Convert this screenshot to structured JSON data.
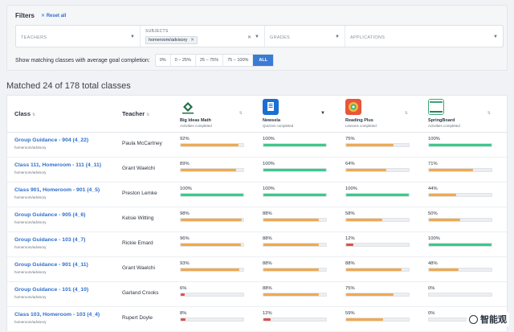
{
  "filters": {
    "title": "Filters",
    "reset_label": "✕ Reset all",
    "teachers_placeholder": "TEACHERS",
    "subjects_label": "SUBJECTS",
    "subjects_chip": "homeroom/advisory",
    "subjects_chip_remove": "✕",
    "subjects_clear": "✕",
    "grades_placeholder": "GRADES",
    "applications_placeholder": "APPLICATIONS",
    "completion_label": "Show matching classes with average goal completion:",
    "completion_options": [
      "0%",
      "0 – 25%",
      "25 – 75%",
      "75 – 100%",
      "ALL"
    ],
    "completion_selected": "ALL"
  },
  "results": {
    "title": "Matched 24 of 178 total classes",
    "col_class": "Class",
    "col_teacher": "Teacher",
    "sort_glyph": "⇅",
    "apps": [
      {
        "name": "Big Ideas Math",
        "metric": "Activities completed",
        "icon": "big-ideas-math-logo"
      },
      {
        "name": "Newsela",
        "metric": "Quizzes completed",
        "icon": "newsela-logo"
      },
      {
        "name": "Reading Plus",
        "metric": "Lessons completed",
        "icon": "reading-plus-logo"
      },
      {
        "name": "SpringBoard",
        "metric": "Activities completed",
        "icon": "springboard-logo"
      }
    ],
    "colors": {
      "green": "#3cc98a",
      "orange": "#f0a94f",
      "red": "#d9534f",
      "link": "#2f6fcf"
    },
    "rows": [
      {
        "name": "Group Guidance - 904 (4_22)",
        "sub": "homeroom/advisory",
        "teacher": "Paula McCartney",
        "metrics": [
          {
            "pct": "92%",
            "v": 0.92,
            "c": "orange"
          },
          {
            "pct": "100%",
            "v": 1.0,
            "c": "green"
          },
          {
            "pct": "75%",
            "v": 0.75,
            "c": "orange"
          },
          {
            "pct": "100%",
            "v": 1.0,
            "c": "green"
          }
        ]
      },
      {
        "name": "Class 111, Homeroom - 111 (4_11)",
        "sub": "homeroom/advisory",
        "teacher": "Grant Waelchi",
        "metrics": [
          {
            "pct": "89%",
            "v": 0.89,
            "c": "orange"
          },
          {
            "pct": "100%",
            "v": 1.0,
            "c": "green"
          },
          {
            "pct": "64%",
            "v": 0.64,
            "c": "orange"
          },
          {
            "pct": "71%",
            "v": 0.71,
            "c": "orange"
          }
        ]
      },
      {
        "name": "Class 901, Homeroom - 901 (4_5)",
        "sub": "homeroom/advisory",
        "teacher": "Preston Lemke",
        "metrics": [
          {
            "pct": "100%",
            "v": 1.0,
            "c": "green"
          },
          {
            "pct": "100%",
            "v": 1.0,
            "c": "green"
          },
          {
            "pct": "100%",
            "v": 1.0,
            "c": "green"
          },
          {
            "pct": "44%",
            "v": 0.44,
            "c": "orange"
          }
        ]
      },
      {
        "name": "Group Guidance - 905 (4_6)",
        "sub": "homeroom/advisory",
        "teacher": "Kelsie Witting",
        "metrics": [
          {
            "pct": "98%",
            "v": 0.98,
            "c": "orange"
          },
          {
            "pct": "88%",
            "v": 0.88,
            "c": "orange"
          },
          {
            "pct": "58%",
            "v": 0.58,
            "c": "orange"
          },
          {
            "pct": "50%",
            "v": 0.5,
            "c": "orange"
          }
        ]
      },
      {
        "name": "Group Guidance - 103 (4_7)",
        "sub": "homeroom/advisory",
        "teacher": "Rickie Emard",
        "metrics": [
          {
            "pct": "96%",
            "v": 0.96,
            "c": "orange"
          },
          {
            "pct": "88%",
            "v": 0.88,
            "c": "orange"
          },
          {
            "pct": "12%",
            "v": 0.12,
            "c": "red"
          },
          {
            "pct": "100%",
            "v": 1.0,
            "c": "green"
          }
        ]
      },
      {
        "name": "Group Guidance - 901 (4_11)",
        "sub": "homeroom/advisory",
        "teacher": "Grant Waelchi",
        "metrics": [
          {
            "pct": "93%",
            "v": 0.93,
            "c": "orange"
          },
          {
            "pct": "88%",
            "v": 0.88,
            "c": "orange"
          },
          {
            "pct": "88%",
            "v": 0.88,
            "c": "orange"
          },
          {
            "pct": "48%",
            "v": 0.48,
            "c": "orange"
          }
        ]
      },
      {
        "name": "Group Guidance - 101 (4_10)",
        "sub": "homeroom/advisory",
        "teacher": "Garland Crooks",
        "metrics": [
          {
            "pct": "6%",
            "v": 0.06,
            "c": "red"
          },
          {
            "pct": "88%",
            "v": 0.88,
            "c": "orange"
          },
          {
            "pct": "75%",
            "v": 0.75,
            "c": "orange"
          },
          {
            "pct": "0%",
            "v": 0.0,
            "c": "red"
          }
        ]
      },
      {
        "name": "Class 103, Homeroom - 103 (4_4)",
        "sub": "homeroom/advisory",
        "teacher": "Rupert Doyle",
        "metrics": [
          {
            "pct": "8%",
            "v": 0.08,
            "c": "red"
          },
          {
            "pct": "12%",
            "v": 0.12,
            "c": "red"
          },
          {
            "pct": "59%",
            "v": 0.59,
            "c": "orange"
          },
          {
            "pct": "0%",
            "v": 0.0,
            "c": "red"
          }
        ]
      }
    ]
  },
  "watermark": {
    "text": "智能观"
  }
}
